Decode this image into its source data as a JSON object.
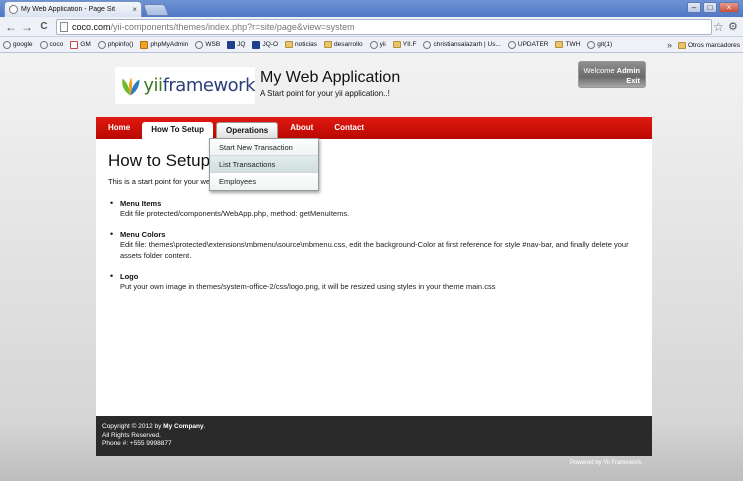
{
  "browser": {
    "tab_title": "My Web Application - Page Sit",
    "tab_close": "×",
    "window_buttons": [
      "–",
      "□",
      "×"
    ],
    "back": "←",
    "forward": "→",
    "reload": "C",
    "url_host": "coco.com",
    "url_path": "/yii-components/themes/index.php?r=site/page&view=system",
    "star": "☆",
    "menu": "🔧",
    "bookmarks": [
      {
        "label": "google",
        "icon": "globe-icon"
      },
      {
        "label": "coco",
        "icon": "globe-icon"
      },
      {
        "label": "GM",
        "icon": "gmail-icon"
      },
      {
        "label": "phpinfo()",
        "icon": "globe-icon"
      },
      {
        "label": "phpMyAdmin",
        "icon": "phpmyadmin-icon"
      },
      {
        "label": "WSB",
        "icon": "globe-icon"
      },
      {
        "label": "JQ",
        "icon": "jquery-icon"
      },
      {
        "label": "JQ-O",
        "icon": "jquery-icon"
      },
      {
        "label": "noticias",
        "icon": "folder-icon"
      },
      {
        "label": "desarrollo",
        "icon": "folder-icon"
      },
      {
        "label": "yii",
        "icon": "globe-icon"
      },
      {
        "label": "YII.F",
        "icon": "folder-icon"
      },
      {
        "label": "christiansalazarh | Us...",
        "icon": "globe-icon"
      },
      {
        "label": "UPDATER",
        "icon": "globe-icon"
      },
      {
        "label": "TWH",
        "icon": "folder-icon"
      },
      {
        "label": "git(1)",
        "icon": "globe-icon"
      }
    ],
    "bookmarks_more": "»",
    "other_bookmarks": "Otros marcadores"
  },
  "header": {
    "logo_yii": "yii",
    "logo_rest": "framework",
    "title": "My Web Application",
    "subtitle": "A Start point for your yii application..!",
    "welcome_prefix": "Welcome",
    "username": "Admin",
    "exit": "Exit"
  },
  "nav": {
    "items": [
      "Home",
      "How To Setup",
      "Operations",
      "About",
      "Contact"
    ],
    "active": "How To Setup",
    "open": "Operations",
    "dropdown": [
      "Start New Transaction",
      "List Transactions",
      "Employees"
    ],
    "dropdown_highlight": "List Transactions"
  },
  "main": {
    "heading": "How to Setup",
    "intro": "This is a start point for your web",
    "steps": [
      {
        "title": "Menu Items",
        "desc": "Edit file protected/components/WebApp.php, method: getMenuItems."
      },
      {
        "title": "Menu Colors",
        "desc": "Edit file: themes\\protected\\extensions\\mbmenu\\source\\mbmenu.css, edit the background-Color at first reference for style #nav-bar, and finally delete your assets folder content."
      },
      {
        "title": "Logo",
        "desc": "Put your own image in themes/system-office-2/css/logo.png, it will be resized using styles in your theme main.css"
      }
    ]
  },
  "footer": {
    "copyright_prefix": "Copyright © 2012 by",
    "company": "My Company",
    "copyright_suffix": ".",
    "rights": "All Rights Reserved.",
    "phone": "Phone #: +555 9998877",
    "powered": "Powered by Yii Framework."
  },
  "colors": {
    "nav_red": "#d0100a",
    "footer_bg": "#2a2a2a",
    "browser_blue": "#5a80c8"
  }
}
